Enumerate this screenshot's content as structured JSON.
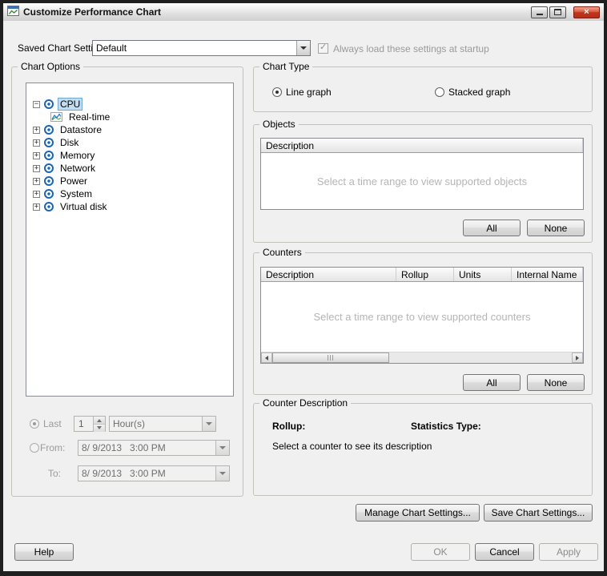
{
  "window": {
    "title": "Customize Performance Chart"
  },
  "icons": {
    "close": "×",
    "check": "✓",
    "collapse": "−",
    "expand": "+"
  },
  "settings_bar": {
    "label": "Saved Chart Settings:",
    "combo_value": "Default",
    "checkbox_label": "Always load these settings at startup"
  },
  "chart_options": {
    "title": "Chart Options",
    "tree": [
      "CPU",
      "Real-time",
      "Datastore",
      "Disk",
      "Memory",
      "Network",
      "Power",
      "System",
      "Virtual disk"
    ],
    "last_label": "Last",
    "last_value": "1",
    "last_unit": "Hour(s)",
    "from_label": "From:",
    "from_value": "8/ 9/2013   3:00 PM",
    "to_label": "To:",
    "to_value": "8/ 9/2013   3:00 PM"
  },
  "chart_type": {
    "title": "Chart Type",
    "line_label": "Line graph",
    "stacked_label": "Stacked graph"
  },
  "objects": {
    "title": "Objects",
    "column": "Description",
    "placeholder": "Select a time range to view supported objects",
    "all_label": "All",
    "none_label": "None"
  },
  "counters": {
    "title": "Counters",
    "columns": [
      "Description",
      "Rollup",
      "Units",
      "Internal Name"
    ],
    "placeholder": "Select a time range to view supported counters",
    "all_label": "All",
    "none_label": "None"
  },
  "counter_description": {
    "title": "Counter Description",
    "rollup_label": "Rollup:",
    "statistics_label": "Statistics Type:",
    "placeholder": "Select a counter to see its description"
  },
  "actions": {
    "manage": "Manage Chart Settings...",
    "save": "Save Chart Settings...",
    "help": "Help",
    "ok": "OK",
    "cancel": "Cancel",
    "apply": "Apply"
  }
}
